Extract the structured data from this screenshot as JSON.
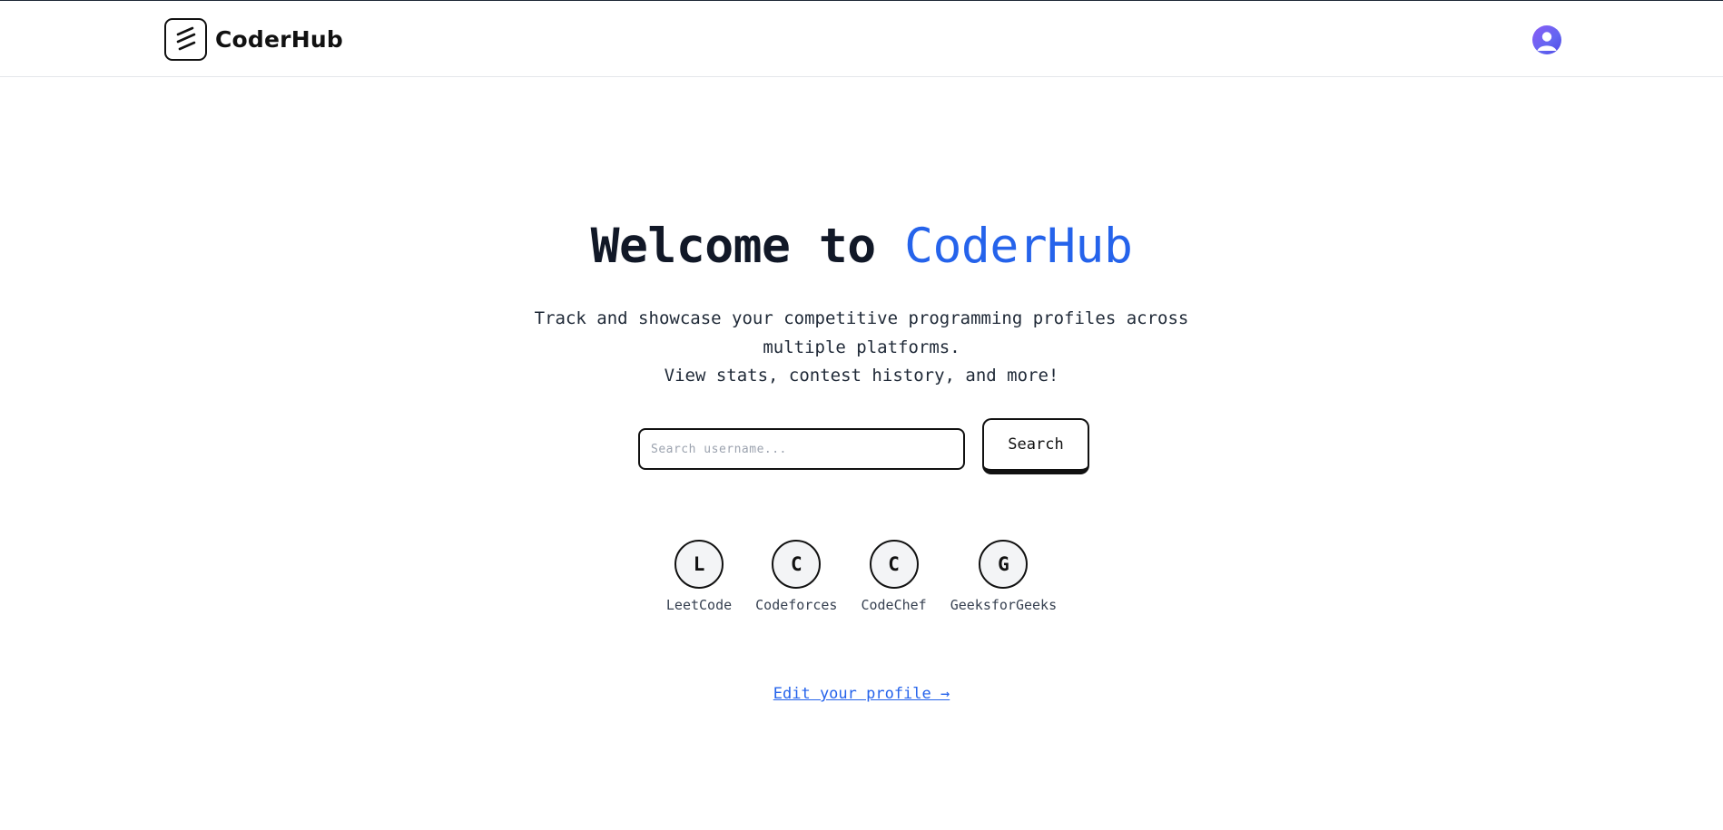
{
  "navbar": {
    "brand_name": "CoderHub",
    "logo_icon": "three-slashes-icon",
    "avatar_icon": "user-avatar-icon"
  },
  "hero": {
    "title_prefix": "Welcome to",
    "title_accent": "CoderHub",
    "tagline_line1": "Track and showcase your competitive programming profiles across",
    "tagline_line2": "multiple platforms.",
    "tagline_line3": "View stats, contest history, and more!"
  },
  "search": {
    "placeholder": "Search username...",
    "value": "",
    "button_label": "Search"
  },
  "platforms": [
    {
      "initial": "L",
      "label": "LeetCode"
    },
    {
      "initial": "C",
      "label": "Codeforces"
    },
    {
      "initial": "C",
      "label": "CodeChef"
    },
    {
      "initial": "G",
      "label": "GeeksforGeeks"
    }
  ],
  "footer": {
    "edit_link": "Edit your profile →"
  },
  "colors": {
    "accent": "#2563eb",
    "text": "#111827",
    "avatar": "#6366f1"
  }
}
